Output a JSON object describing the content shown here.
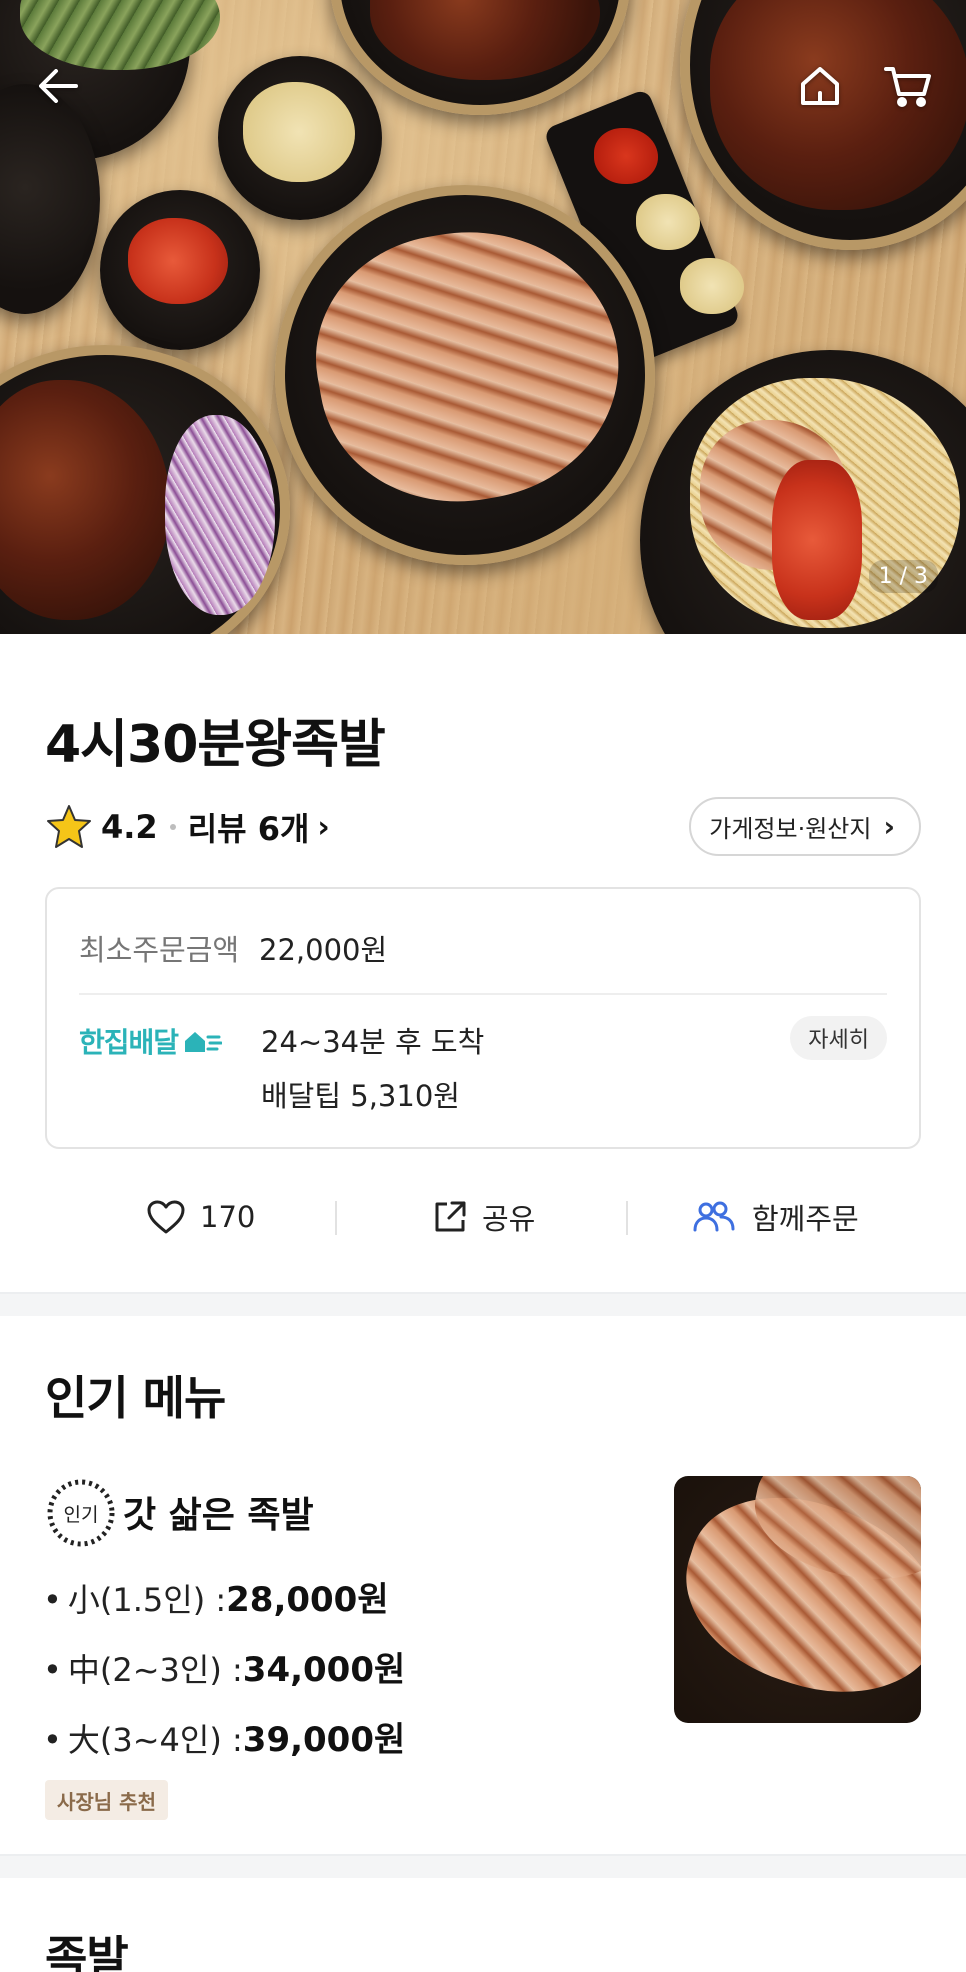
{
  "hero": {
    "photo_counter": "1 / 3"
  },
  "store": {
    "name": "4시30분왕족발",
    "rating": "4.2",
    "reviews_label": "리뷰 6개",
    "info_button": "가게정보·원산지"
  },
  "delivery": {
    "min_order_label": "최소주문금액",
    "min_order_value": "22,000원",
    "service_name": "한집배달",
    "eta": "24~34분 후 도착",
    "tip": "배달팁 5,310원",
    "detail_button": "자세히"
  },
  "actions": {
    "likes": "170",
    "share": "공유",
    "group_order": "함께주문"
  },
  "popular": {
    "title": "인기 메뉴",
    "badge": "인기",
    "menu_name": "갓 삶은 족발",
    "prices": [
      {
        "bullet": "•",
        "size": "小(1.5인) : ",
        "amount": "28,000원"
      },
      {
        "bullet": "•",
        "size": "中(2~3인) : ",
        "amount": "34,000원"
      },
      {
        "bullet": "•",
        "size": "大(3~4인) : ",
        "amount": "39,000원"
      }
    ],
    "tag": "사장님 추천"
  },
  "next_section": {
    "title": "족발"
  },
  "colors": {
    "accent_teal": "#2bb3b8",
    "group_icon_blue": "#3e6fe0",
    "star": "#f5c518"
  }
}
